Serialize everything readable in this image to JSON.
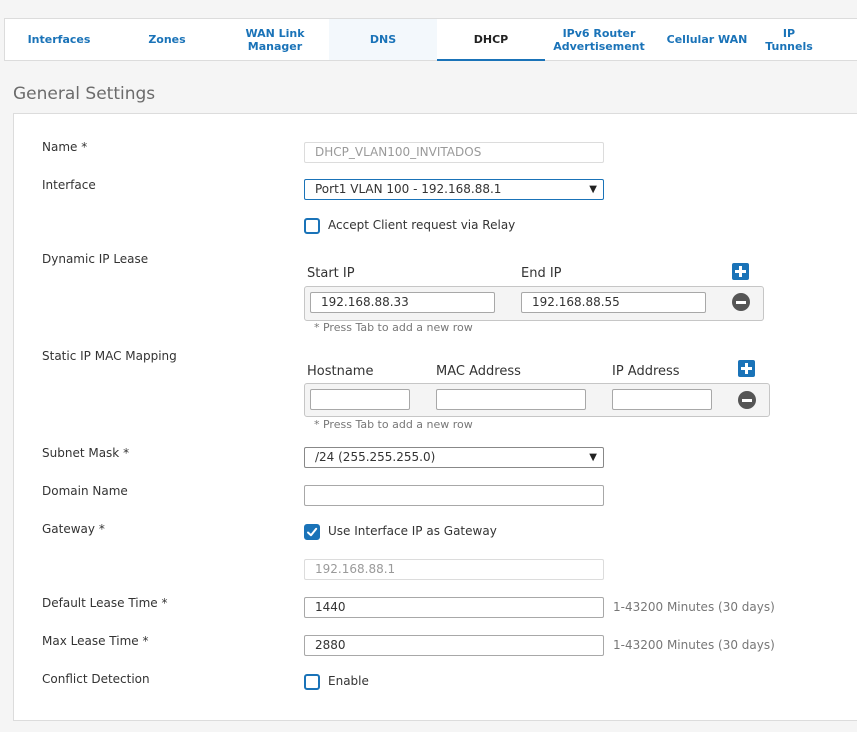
{
  "tabs": [
    {
      "label": "Interfaces"
    },
    {
      "label": "Zones"
    },
    {
      "label": "WAN Link Manager"
    },
    {
      "label": "DNS"
    },
    {
      "label": "DHCP"
    },
    {
      "label": "IPv6 Router Advertisement"
    },
    {
      "label": "Cellular WAN"
    },
    {
      "label": "IP Tunnels"
    }
  ],
  "active_tab": "DHCP",
  "section_title": "General Settings",
  "form": {
    "name": {
      "label": "Name *",
      "value": "DHCP_VLAN100_INVITADOS"
    },
    "interface": {
      "label": "Interface",
      "value": "Port1 VLAN 100 - 192.168.88.1"
    },
    "relay": {
      "label": "Accept Client request via Relay",
      "checked": false
    },
    "dynamic_lease": {
      "label": "Dynamic IP Lease",
      "start_header": "Start IP",
      "end_header": "End IP",
      "start_value": "192.168.88.33",
      "end_value": "192.168.88.55",
      "hint": "* Press Tab to add a new row"
    },
    "static_mapping": {
      "label": "Static IP MAC Mapping",
      "hostname_header": "Hostname",
      "mac_header": "MAC Address",
      "ip_header": "IP Address",
      "hostname_value": "",
      "mac_value": "",
      "ip_value": "",
      "hint": "* Press Tab to add a new row"
    },
    "subnet_mask": {
      "label": "Subnet Mask *",
      "value": "/24 (255.255.255.0)"
    },
    "domain_name": {
      "label": "Domain Name",
      "value": ""
    },
    "gateway": {
      "label": "Gateway *",
      "checkbox_label": "Use Interface IP as Gateway",
      "checked": true,
      "value": "192.168.88.1"
    },
    "default_lease": {
      "label": "Default Lease Time *",
      "value": "1440",
      "unit": "1-43200 Minutes (30 days)"
    },
    "max_lease": {
      "label": "Max Lease Time *",
      "value": "2880",
      "unit": "1-43200 Minutes (30 days)"
    },
    "conflict": {
      "label": "Conflict Detection",
      "checkbox_label": "Enable",
      "checked": false
    }
  },
  "colors": {
    "accent": "#1a73b8",
    "border": "#dcdcdc"
  }
}
